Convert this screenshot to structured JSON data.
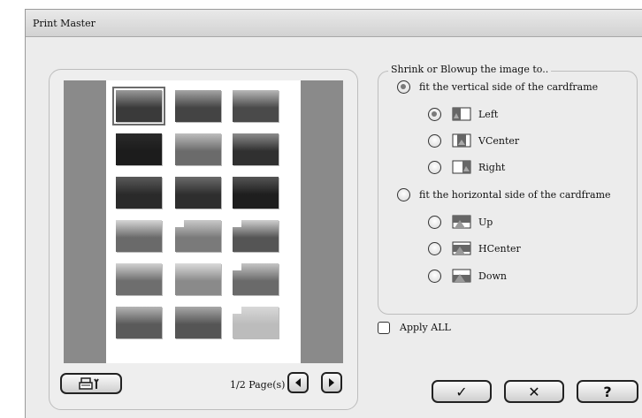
{
  "window": {
    "title": "Print Master"
  },
  "preview": {
    "thumbnails": [
      {
        "sky": "#9a9a9a",
        "land": "#3a3a3a",
        "selected": true,
        "cut": false
      },
      {
        "sky": "#a5a5a5",
        "land": "#444444",
        "selected": false,
        "cut": false
      },
      {
        "sky": "#b8b8b8",
        "land": "#4a4a4a",
        "selected": false,
        "cut": false
      },
      {
        "sky": "#2a2a2a",
        "land": "#1c1c1c",
        "selected": false,
        "cut": false
      },
      {
        "sky": "#bdbdbd",
        "land": "#6b6b6b",
        "selected": false,
        "cut": false
      },
      {
        "sky": "#8c8c8c",
        "land": "#303030",
        "selected": false,
        "cut": false
      },
      {
        "sky": "#5a5a5a",
        "land": "#2a2a2a",
        "selected": false,
        "cut": false
      },
      {
        "sky": "#6a6a6a",
        "land": "#2e2e2e",
        "selected": false,
        "cut": false
      },
      {
        "sky": "#555555",
        "land": "#1e1e1e",
        "selected": false,
        "cut": false
      },
      {
        "sky": "#d6d6d6",
        "land": "#6a6a6a",
        "selected": false,
        "cut": false
      },
      {
        "sky": "#c9c9c9",
        "land": "#7a7a7a",
        "selected": false,
        "cut": true
      },
      {
        "sky": "#cfcfcf",
        "land": "#555555",
        "selected": false,
        "cut": true
      },
      {
        "sky": "#d2d2d2",
        "land": "#6e6e6e",
        "selected": false,
        "cut": false
      },
      {
        "sky": "#dadada",
        "land": "#8a8a8a",
        "selected": false,
        "cut": false
      },
      {
        "sky": "#c5c5c5",
        "land": "#6a6a6a",
        "selected": false,
        "cut": true
      },
      {
        "sky": "#b5b5b5",
        "land": "#5a5a5a",
        "selected": false,
        "cut": false
      },
      {
        "sky": "#a8a8a8",
        "land": "#555555",
        "selected": false,
        "cut": false
      },
      {
        "sky": "#d8d8d8",
        "land": "#bcbcbc",
        "selected": false,
        "cut": true
      }
    ],
    "page_count_label": "1/2 Page(s)"
  },
  "options": {
    "legend": "Shrink or Blowup the image to..",
    "vertical": {
      "label": "fit the vertical side of the cardframe",
      "checked": true
    },
    "vertical_subs": [
      {
        "label": "Left",
        "icon": "align-left-icon",
        "checked": true
      },
      {
        "label": "VCenter",
        "icon": "align-vcenter-icon",
        "checked": false
      },
      {
        "label": "Right",
        "icon": "align-right-icon",
        "checked": false
      }
    ],
    "horizontal": {
      "label": "fit the horizontal side of the cardframe",
      "checked": false
    },
    "horizontal_subs": [
      {
        "label": "Up",
        "icon": "align-up-icon",
        "checked": false
      },
      {
        "label": "HCenter",
        "icon": "align-hcenter-icon",
        "checked": false
      },
      {
        "label": "Down",
        "icon": "align-down-icon",
        "checked": false
      }
    ]
  },
  "apply_all": {
    "label": "Apply ALL",
    "checked": false
  },
  "buttons": {
    "ok": "✓",
    "cancel": "✕",
    "help": "?"
  }
}
